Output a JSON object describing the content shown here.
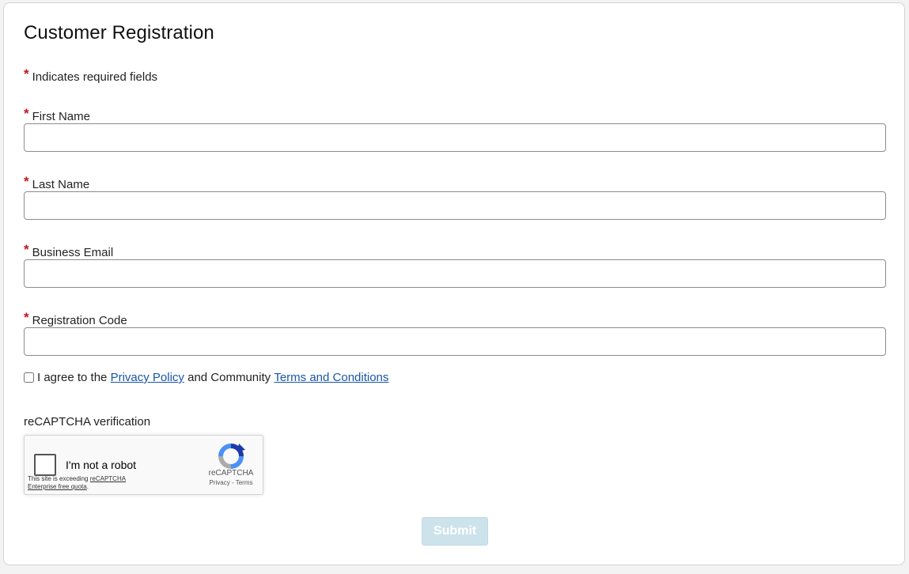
{
  "form": {
    "title": "Customer Registration",
    "required_marker": "*",
    "required_note": "Indicates required fields",
    "fields": [
      {
        "label": "First Name",
        "value": ""
      },
      {
        "label": "Last Name",
        "value": ""
      },
      {
        "label": "Business Email",
        "value": ""
      },
      {
        "label": "Registration Code",
        "value": ""
      }
    ],
    "agree": {
      "prefix": "I agree to the",
      "privacy_link": "Privacy Policy",
      "middle": "and Community",
      "terms_link": "Terms and Conditions",
      "checked": false
    },
    "captcha_label": "reCAPTCHA verification",
    "submit_label": "Submit"
  },
  "recaptcha": {
    "checkbox_text": "I'm not a robot",
    "note_prefix": "This site is exceeding",
    "note_link": "reCAPTCHA Enterprise free quota",
    "note_suffix": ".",
    "brand": "reCAPTCHA",
    "privacy": "Privacy",
    "separator": " - ",
    "terms": "Terms"
  },
  "colors": {
    "required_star": "#c0171f",
    "link": "#1a56a8",
    "submit_disabled_bg": "#cde3ec"
  }
}
